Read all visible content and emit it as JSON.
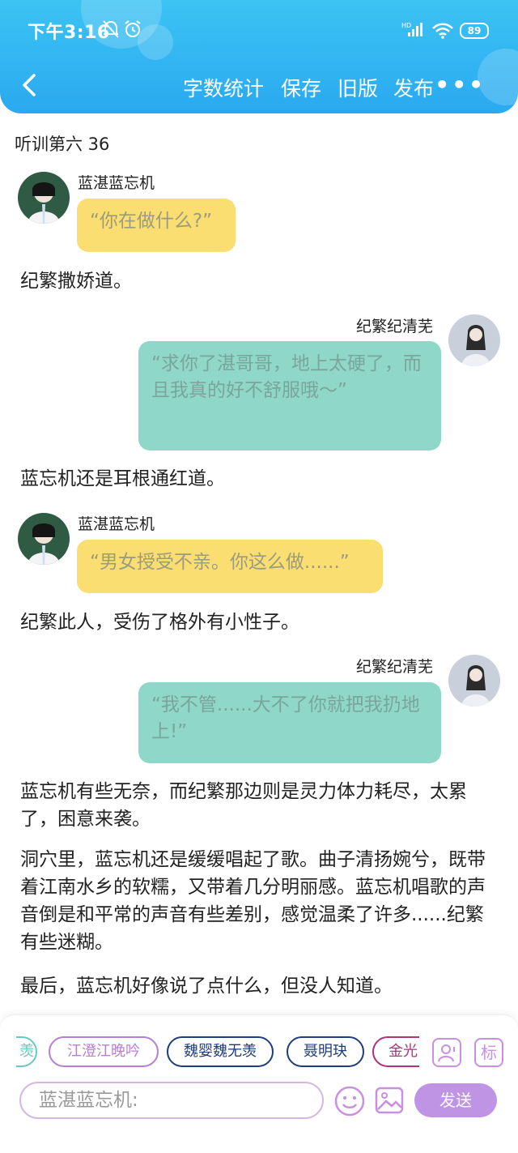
{
  "status_bar": {
    "time": "下午3:16",
    "battery": "89",
    "network": "HD"
  },
  "toolbar": {
    "word_count": "字数统计",
    "save": "保存",
    "old_version": "旧版",
    "publish": "发布",
    "more": "•••"
  },
  "chapter_title": "听训第六 36",
  "messages": [
    {
      "kind": "left",
      "name": "蓝湛蓝忘机",
      "text": "“你在做什么?”"
    },
    {
      "kind": "narr",
      "text": "纪繁撒娇道。"
    },
    {
      "kind": "right",
      "name": "纪繁纪清芜",
      "text": "“求你了湛哥哥，地上太硬了，而且我真的好不舒服哦～”"
    },
    {
      "kind": "narr",
      "text": "蓝忘机还是耳根通红道。"
    },
    {
      "kind": "left",
      "name": "蓝湛蓝忘机",
      "text": "“男女授受不亲。你这么做......”"
    },
    {
      "kind": "narr",
      "text": "纪繁此人，受伤了格外有小性子。"
    },
    {
      "kind": "right",
      "name": "纪繁纪清芜",
      "text": "“我不管......大不了你就把我扔地上!”"
    },
    {
      "kind": "narr",
      "text": "蓝忘机有些无奈，而纪繁那边则是灵力体力耗尽，太累了，困意来袭。"
    },
    {
      "kind": "narr",
      "text": "洞穴里，蓝忘机还是缓缓唱起了歌。曲子清扬婉兮，既带着江南水乡的软糯，又带着几分明丽感。蓝忘机唱歌的声音倒是和平常的声音有些差别，感觉温柔了许多......纪繁有些迷糊。"
    },
    {
      "kind": "narr",
      "text": "最后，蓝忘机好像说了点什么，但没人知道。"
    }
  ],
  "chips": [
    {
      "label": "羡",
      "color": "#6cc6c4"
    },
    {
      "label": "江澄江晚吟",
      "color": "#b77ed3"
    },
    {
      "label": "魏婴魏无羡",
      "color": "#1f3d78"
    },
    {
      "label": "聂明玦",
      "color": "#1f3d78"
    },
    {
      "label": "金光",
      "color": "#b0327a"
    }
  ],
  "side_buttons": {
    "mark": "标"
  },
  "composer": {
    "placeholder": "蓝湛蓝忘机:",
    "send": "发送"
  },
  "colors": {
    "header": "#2aa9f0",
    "yellow_bubble": "#fbde71",
    "teal_bubble": "#8fd8c9",
    "accent": "#c094e4"
  }
}
